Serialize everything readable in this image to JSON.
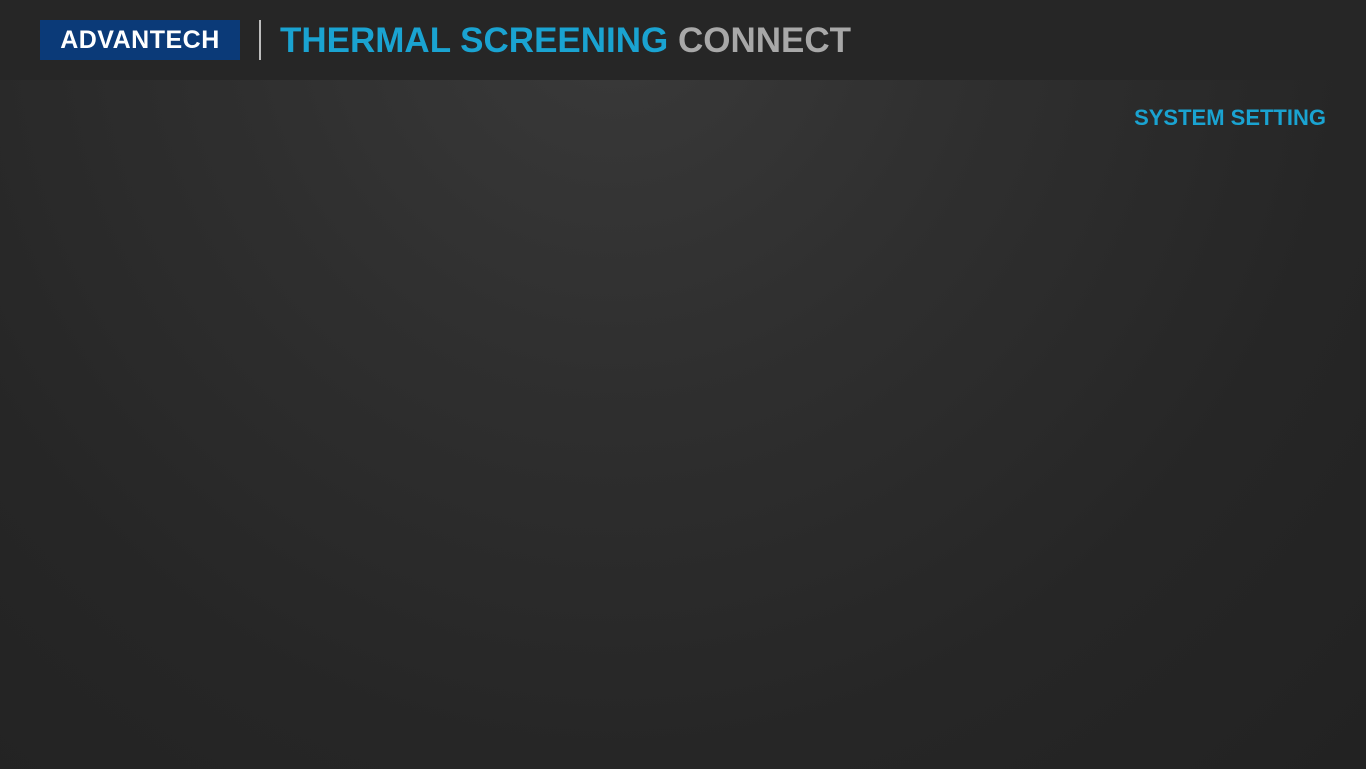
{
  "header": {
    "logo_text": "ADVANTECH",
    "title_accent": "THERMAL SCREENING",
    "title_rest": "CONNECT"
  },
  "nav": {
    "system_setting_label": "SYSTEM SETTING"
  },
  "colors": {
    "accent": "#1aa3d1",
    "logo_background": "#0b3a78",
    "header_background": "#262626"
  }
}
